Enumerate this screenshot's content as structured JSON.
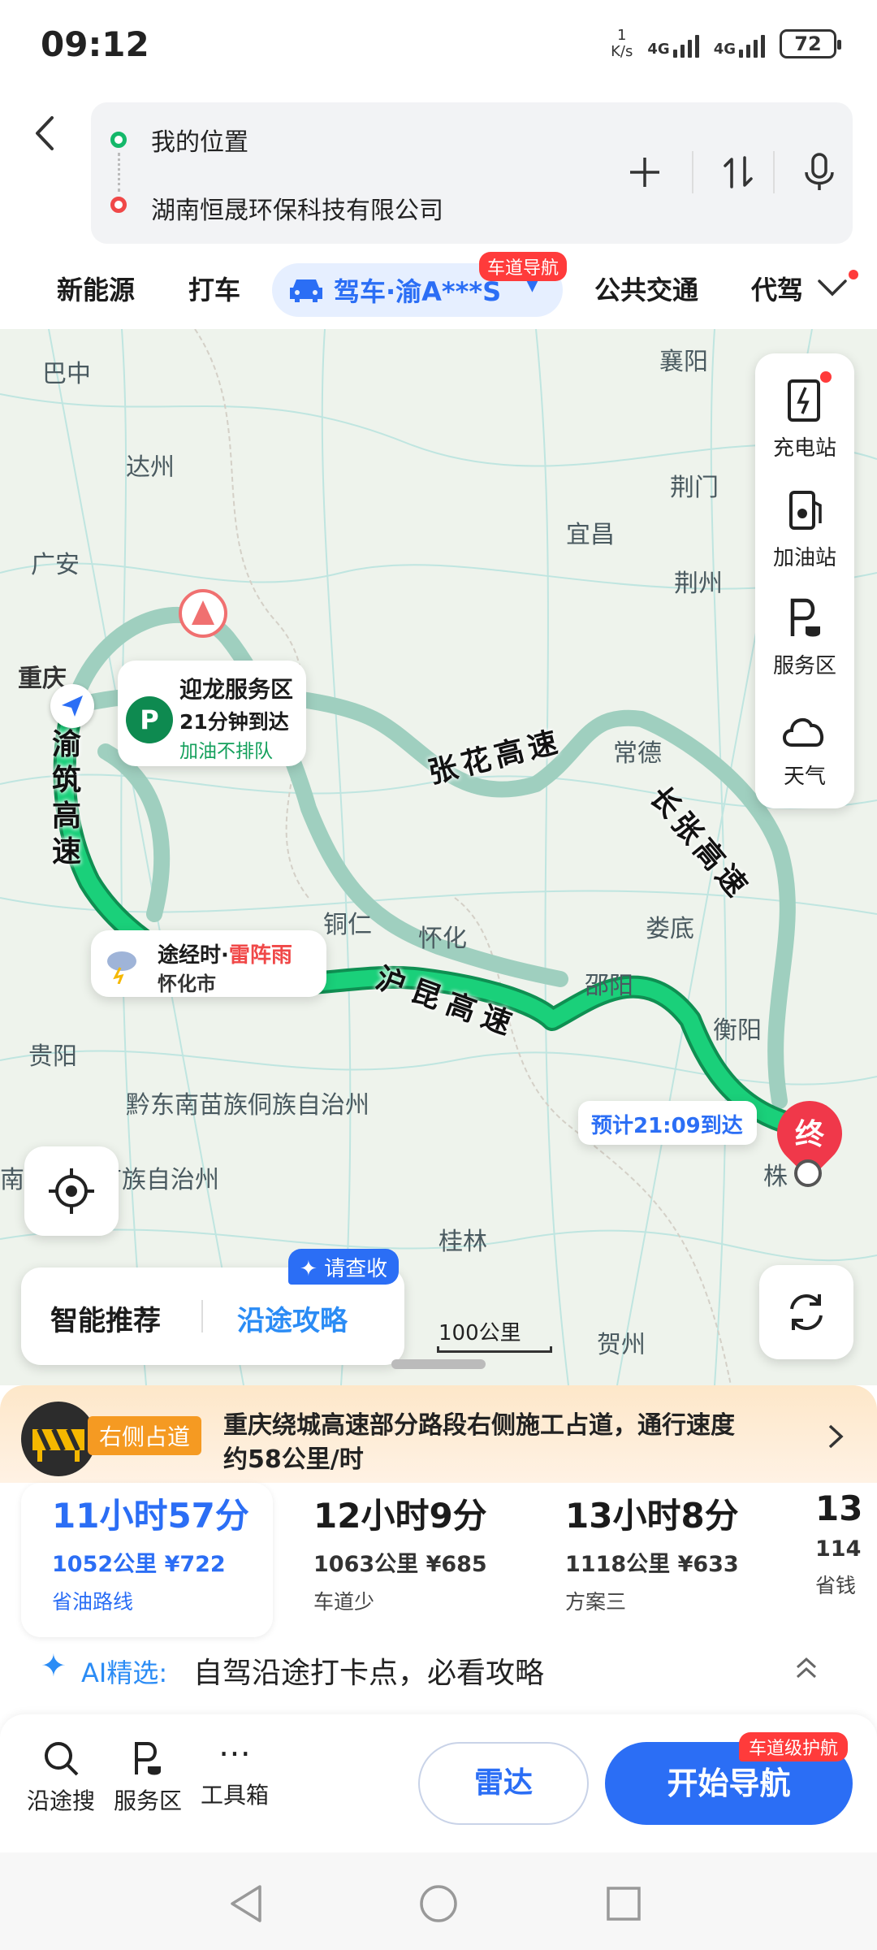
{
  "status_bar": {
    "time": "09:12",
    "speed_top": "1",
    "speed_bottom": "K/s",
    "net1": "4G",
    "net2": "4G",
    "battery": "72"
  },
  "search": {
    "origin": "我的位置",
    "destination": "湖南恒晟环保科技有限公司"
  },
  "mode_tabs": {
    "items": [
      "新能源",
      "打车",
      "驾车·渝A***S",
      "公共交通",
      "代驾"
    ],
    "active_badge": "车道导航"
  },
  "map": {
    "cities": [
      "巴中",
      "达州",
      "广安",
      "重庆",
      "襄阳",
      "荆门",
      "宜昌",
      "荆州",
      "常德",
      "娄底",
      "邵阳",
      "衡阳",
      "怀化",
      "铜仁",
      "贵阳",
      "黔东南苗族侗族自治州",
      "南布依族苗族自治州",
      "桂林",
      "贺州",
      "株"
    ],
    "roads": [
      "渝筑高速",
      "张花高速",
      "长张高速",
      "沪昆高速"
    ],
    "service_area": {
      "name": "迎龙服务区",
      "time": "21分钟到达",
      "note": "加油不排队"
    },
    "weather": {
      "title": "途经时·",
      "condition": "雷阵雨",
      "place": "怀化市"
    },
    "eta": "预计21:09到达",
    "end_label": "终",
    "scale": "100公里",
    "right_panel": [
      "充电站",
      "加油站",
      "服务区",
      "天气"
    ],
    "recommend": {
      "left": "智能推荐",
      "right": "沿途攻略",
      "badge": "请查收"
    },
    "road_colors": {
      "route": "#14b86a",
      "alt": "#9fcfbf",
      "accent": "#2b6ef5"
    }
  },
  "alert": {
    "tag": "右侧占道",
    "line1": "重庆绕城高速部分路段右侧施工占道，通行速度",
    "line2": "约58公里/时"
  },
  "routes": [
    {
      "time": "11小时57分",
      "distance": "1052公里",
      "cost": "¥722",
      "tag": "省油路线",
      "selected": true
    },
    {
      "time": "12小时9分",
      "distance": "1063公里",
      "cost": "¥685",
      "tag": "车道少"
    },
    {
      "time": "13小时8分",
      "distance": "1118公里",
      "cost": "¥633",
      "tag": "方案三"
    },
    {
      "time": "13",
      "distance": "114",
      "cost": "",
      "tag": "省钱"
    }
  ],
  "ai": {
    "label": "AI精选:",
    "text": "自驾沿途打卡点，必看攻略"
  },
  "bottom_bar": {
    "items": [
      "沿途搜",
      "服务区",
      "工具箱"
    ],
    "radar": "雷达",
    "start": "开始导航",
    "start_badge": "车道级护航"
  }
}
